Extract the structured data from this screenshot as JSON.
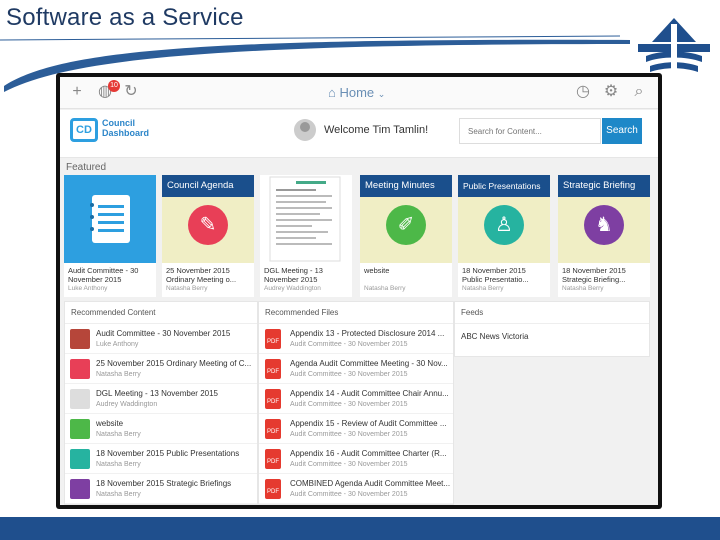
{
  "slide": {
    "title": "Software as a Service"
  },
  "topbar": {
    "add_icon": "plus-icon",
    "globe_icon": "globe-icon",
    "notification_count": "10",
    "refresh_icon": "refresh-icon",
    "home_label": "Home",
    "history_icon": "clock-icon",
    "settings_icon": "gear-icon",
    "search_icon": "magnifier-icon"
  },
  "header": {
    "logo_letters": "CD",
    "logo_line1": "Council",
    "logo_line2": "Dashboard",
    "welcome": "Welcome Tim Tamlin!",
    "search_placeholder": "Search for Content...",
    "search_button": "Search"
  },
  "featured": {
    "label": "Featured",
    "tiles": [
      {
        "heading": "",
        "caption": "Audit Committee - 30 November 2015",
        "author": "Luke Anthony",
        "icon": "notebook-icon",
        "color": "#2d9fe0"
      },
      {
        "heading": "Council Agenda",
        "caption": "25 November 2015 Ordinary Meeting o...",
        "author": "Natasha Berry",
        "icon": "document-pen-icon",
        "color": "#e83f57"
      },
      {
        "heading": "",
        "caption": "DGL Meeting - 13 November 2015",
        "author": "Audrey Waddington",
        "icon": "document-thumbnail",
        "color": "#ffffff"
      },
      {
        "heading": "Meeting Minutes",
        "caption": "website",
        "author": "Natasha Berry",
        "icon": "pencil-icon",
        "color": "#4db848"
      },
      {
        "heading": "Public Presentations",
        "caption": "18 November 2015 Public Presentatio...",
        "author": "Natasha Berry",
        "icon": "presenter-icon",
        "color": "#26b3a0"
      },
      {
        "heading": "Strategic Briefing",
        "caption": "18 November 2015 Strategic Briefing...",
        "author": "Natasha Berry",
        "icon": "chess-knight-icon",
        "color": "#7e3fa2"
      }
    ]
  },
  "recommended_content": {
    "label": "Recommended Content",
    "items": [
      {
        "title": "Audit Committee - 30 November 2015",
        "author": "Luke Anthony"
      },
      {
        "title": "25 November 2015 Ordinary Meeting of C...",
        "author": "Natasha Berry"
      },
      {
        "title": "DGL Meeting - 13 November 2015",
        "author": "Audrey Waddington"
      },
      {
        "title": "website",
        "author": "Natasha Berry"
      },
      {
        "title": "18 November 2015 Public Presentations",
        "author": "Natasha Berry"
      },
      {
        "title": "18 November 2015 Strategic Briefings",
        "author": "Natasha Berry"
      }
    ]
  },
  "recommended_files": {
    "label": "Recommended Files",
    "items": [
      {
        "title": "Appendix 13 - Protected Disclosure 2014 ...",
        "sub": "Audit Committee - 30 November 2015"
      },
      {
        "title": "Agenda Audit Committee Meeting - 30 Nov...",
        "sub": "Audit Committee - 30 November 2015"
      },
      {
        "title": "Appendix 14 - Audit Committee Chair Annu...",
        "sub": "Audit Committee - 30 November 2015"
      },
      {
        "title": "Appendix 15 - Review of Audit Committee ...",
        "sub": "Audit Committee - 30 November 2015"
      },
      {
        "title": "Appendix 16 - Audit Committee Charter (R...",
        "sub": "Audit Committee - 30 November 2015"
      },
      {
        "title": "COMBINED Agenda Audit Committee Meet...",
        "sub": "Audit Committee - 30 November 2015"
      }
    ],
    "file_badge": "PDF"
  },
  "feeds": {
    "label": "Feeds",
    "items": [
      "ABC News Victoria"
    ]
  },
  "colors": {
    "accent": "#1e88c8",
    "bottom_bar": "#1f4f8d",
    "title": "#1f3a63"
  }
}
